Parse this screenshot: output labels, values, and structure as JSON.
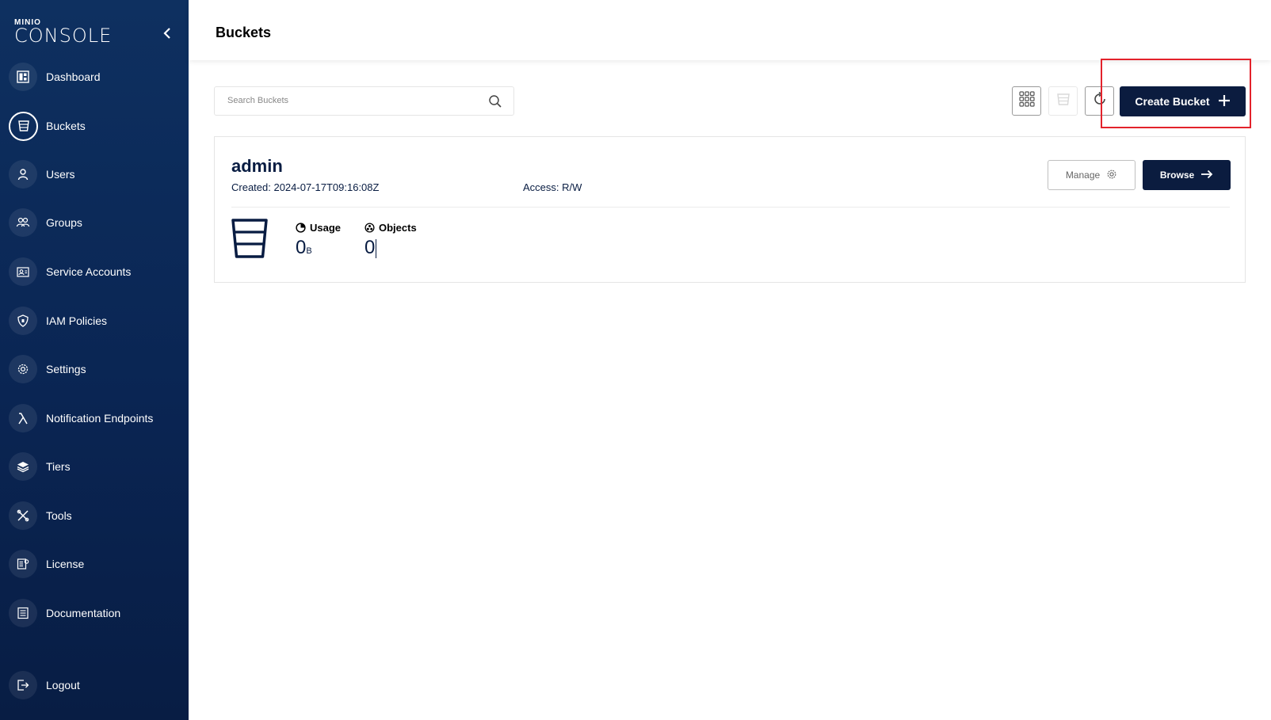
{
  "app": {
    "logo_top": "MINIO",
    "logo_bottom": "CONSOLE"
  },
  "sidebar": {
    "items": [
      {
        "label": "Dashboard",
        "icon": "dashboard-icon"
      },
      {
        "label": "Buckets",
        "icon": "bucket-icon",
        "active": true
      },
      {
        "label": "Users",
        "icon": "user-icon"
      },
      {
        "label": "Groups",
        "icon": "groups-icon"
      },
      {
        "label": "Service Accounts",
        "icon": "service-accounts-icon"
      },
      {
        "label": "IAM Policies",
        "icon": "shield-icon"
      },
      {
        "label": "Settings",
        "icon": "gear-icon"
      },
      {
        "label": "Notification Endpoints",
        "icon": "lambda-icon"
      },
      {
        "label": "Tiers",
        "icon": "layers-icon"
      },
      {
        "label": "Tools",
        "icon": "tools-icon"
      },
      {
        "label": "License",
        "icon": "license-icon"
      },
      {
        "label": "Documentation",
        "icon": "documentation-icon"
      },
      {
        "label": "Logout",
        "icon": "logout-icon"
      }
    ]
  },
  "header": {
    "title": "Buckets"
  },
  "toolbar": {
    "search_placeholder": "Search Buckets",
    "create_label": "Create Bucket"
  },
  "bucket": {
    "name": "admin",
    "created": "Created: 2024-07-17T09:16:08Z",
    "access": "Access: R/W",
    "manage_label": "Manage",
    "browse_label": "Browse",
    "usage_label": "Usage",
    "usage_value": "0",
    "usage_unit": "B",
    "objects_label": "Objects",
    "objects_value": "0"
  },
  "colors": {
    "sidebar": "#0a2553",
    "primary": "#0b1c3f",
    "highlight": "#e3222b"
  }
}
